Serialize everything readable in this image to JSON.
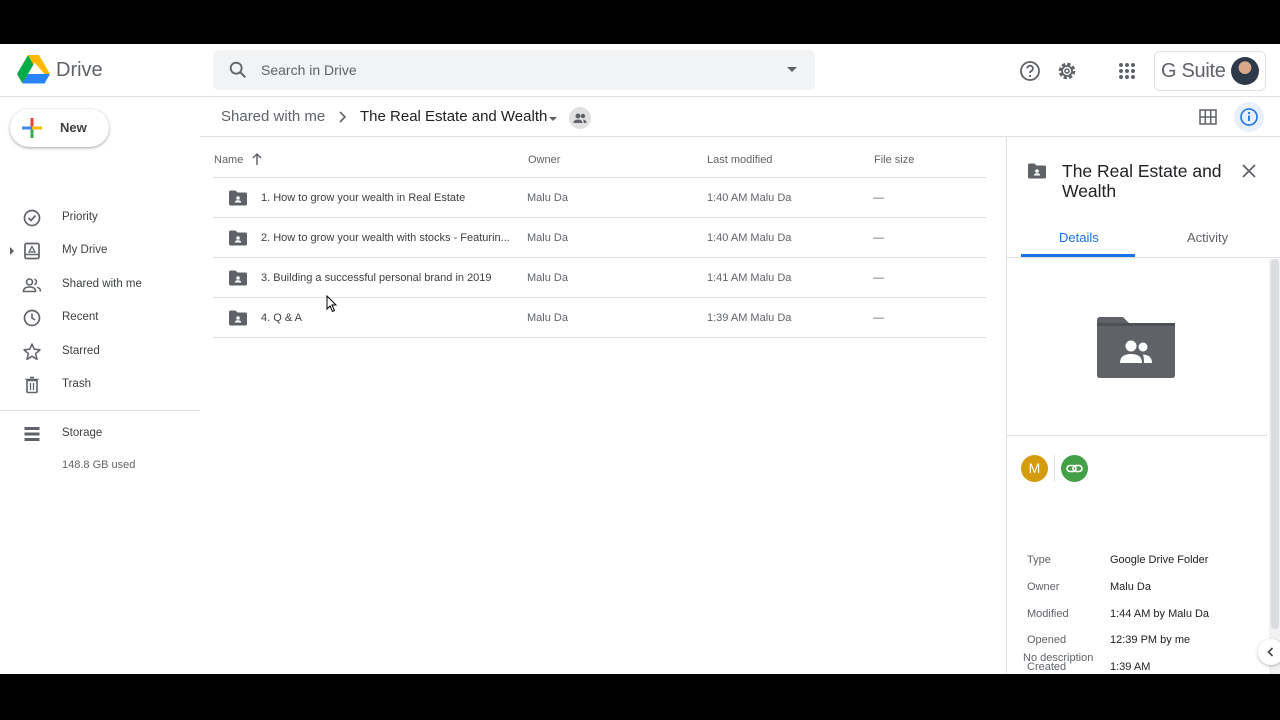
{
  "app": {
    "name": "Drive",
    "suite_label": "G Suite"
  },
  "search": {
    "placeholder": "Search in Drive"
  },
  "sidebar": {
    "new_label": "New",
    "items": [
      {
        "label": "Priority",
        "icon": "priority-icon"
      },
      {
        "label": "My Drive",
        "icon": "my-drive-icon"
      },
      {
        "label": "Shared with me",
        "icon": "shared-icon"
      },
      {
        "label": "Recent",
        "icon": "clock-icon"
      },
      {
        "label": "Starred",
        "icon": "star-icon"
      },
      {
        "label": "Trash",
        "icon": "trash-icon"
      }
    ],
    "storage": {
      "label": "Storage",
      "used": "148.8 GB used"
    }
  },
  "breadcrumb": {
    "parent": "Shared with me",
    "current": "The Real Estate and Wealth"
  },
  "list": {
    "columns": {
      "name": "Name",
      "owner": "Owner",
      "modified": "Last modified",
      "size": "File size"
    },
    "rows": [
      {
        "name": "1. How to grow your wealth in Real Estate",
        "owner": "Malu Da",
        "modified": "1:40 AM  Malu Da",
        "size": "—"
      },
      {
        "name": "2. How to grow your wealth with stocks - Featurin...",
        "owner": "Malu Da",
        "modified": "1:40 AM  Malu Da",
        "size": "—"
      },
      {
        "name": "3. Building a successful personal brand in 2019",
        "owner": "Malu Da",
        "modified": "1:41 AM  Malu Da",
        "size": "—"
      },
      {
        "name": "4. Q & A",
        "owner": "Malu Da",
        "modified": "1:39 AM  Malu Da",
        "size": "—"
      }
    ]
  },
  "details": {
    "title": "The Real Estate and Wealth",
    "tabs": {
      "details": "Details",
      "activity": "Activity"
    },
    "avatar_letter": "M",
    "props": [
      {
        "label": "Type",
        "value": "Google Drive Folder"
      },
      {
        "label": "Owner",
        "value": "Malu Da"
      },
      {
        "label": "Modified",
        "value": "1:44 AM by Malu Da"
      },
      {
        "label": "Opened",
        "value": "12:39 PM by me"
      },
      {
        "label": "Created",
        "value": "1:39 AM"
      }
    ],
    "no_description": "No description"
  },
  "colors": {
    "accent": "#1a73e8",
    "avatar": "#d49b0c",
    "link_badge": "#43a047"
  }
}
